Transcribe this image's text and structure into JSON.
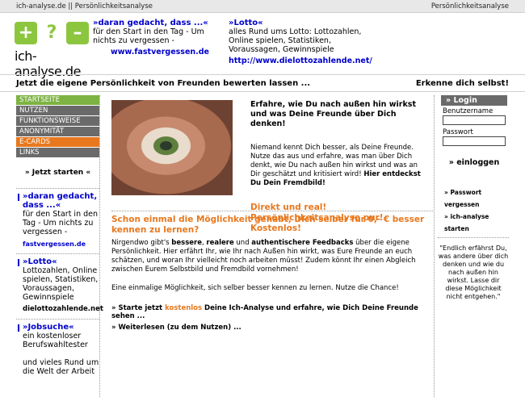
{
  "topbar": {
    "left": "ich-analyse.de || Persönlichkeitsanalyse",
    "right": "Persönlichkeitsanalyse"
  },
  "logo": {
    "brand": "ich-analyse.de",
    "symbols": [
      "+",
      "?",
      "–"
    ],
    "color": "#8cc63f"
  },
  "ad1": {
    "headline": "»daran gedacht, dass ...«",
    "text": "für den Start in den Tag - Um nichts zu vergessen -",
    "link": "www.fastvergessen.de"
  },
  "ad2": {
    "headline": "»Lotto«",
    "text": "alles Rund ums Lotto: Lottozahlen, Online spielen, Statistiken, Voraussagen, Gewinnspiele",
    "link": "http://www.dielottozahlende.net/"
  },
  "tagline": {
    "left": "Jetzt die eigene Persönlichkeit von Freunden bewerten lassen ...",
    "right": "Erkenne dich selbst!"
  },
  "nav": [
    {
      "label": "STARTSEITE",
      "color": "#7cb342"
    },
    {
      "label": "NUTZEN",
      "color": "#6a6a6a"
    },
    {
      "label": "FUNKTIONSWEISE",
      "color": "#6a6a6a"
    },
    {
      "label": "ANONYMITÄT",
      "color": "#6a6a6a"
    },
    {
      "label": "E-CARDS",
      "color": "#e8781e"
    },
    {
      "label": "LINKS",
      "color": "#6a6a6a"
    }
  ],
  "jetzt_starten": "» Jetzt starten «",
  "left_ads": [
    {
      "headline": "»daran gedacht, dass ...«",
      "text": "für den Start in den Tag - Um nichts zu vergessen -",
      "link": "fastvergessen.de",
      "link_style": "blue"
    },
    {
      "headline": "»Lotto«",
      "text": "Lottozahlen, Online spielen, Statistiken, Voraussagen, Gewinnspiele",
      "link": "dielottozahlende.net",
      "link_style": "black"
    },
    {
      "headline": "»Jobsuche«",
      "text": "ein kostenloser Berufswahltester",
      "text2": "und vieles Rund um die Welt der Arbeit",
      "link": "",
      "link_style": "blue"
    }
  ],
  "hero": {
    "title": "Erfahre, wie Du nach außen hin wirkst und was Deine Freunde über Dich denken!",
    "body": "Niemand kennt Dich besser, als Deine Freunde. Nutze das aus und erfahre, was man über Dich denkt, wie Du nach außen hin wirkst und was an Dir geschätzt und kritisiert wird!",
    "body_bold": "Hier entdeckst Du Dein Fremdbild!",
    "cta": "Direkt und real! Persönlichkeitsanalyse pur! Kostenlos!"
  },
  "question": "Schon einmal die Möglichkeit gehabt, Dich selber für 0,- € besser kennen zu lernen?",
  "paragraph1": {
    "pre": "Nirgendwo gibt's ",
    "b1": "bessere",
    "m1": ", ",
    "b2": "realere",
    "m2": " und ",
    "b3": "authentischere Feedbacks",
    "rest": " über die eigene Persönlichkeit. Hier erfährt Ihr, wie Ihr nach Außen hin wirkt, was Eure Freunde an euch schätzen, und woran Ihr vielleicht noch arbeiten müsst! Zudem könnt Ihr einen Abgleich zwischen Eurem Selbstbild und Fremdbild vornehmen!"
  },
  "paragraph2": "Eine einmalige Möglichkeit, sich selber besser kennen zu lernen. Nutze die Chance!",
  "link1": {
    "pre": "» Starte jetzt ",
    "orange": "kostenlos",
    "post": " Deine Ich-Analyse und erfahre, wie Dich Deine Freunde sehen ..."
  },
  "link2": "» Weiterlesen (zu dem Nutzen) ...",
  "login": {
    "title": "» Login",
    "user_label": "Benutzername",
    "pass_label": "Passwort",
    "submit": "» einloggen",
    "forgot": "» Passwort vergessen",
    "start": "» ich-analyse starten"
  },
  "quote": "\"Endlich erfährst Du, was andere über dich denken und wie du nach außen hin wirkst. Lasse dir diese Möglichkeit nicht entgehen.\""
}
